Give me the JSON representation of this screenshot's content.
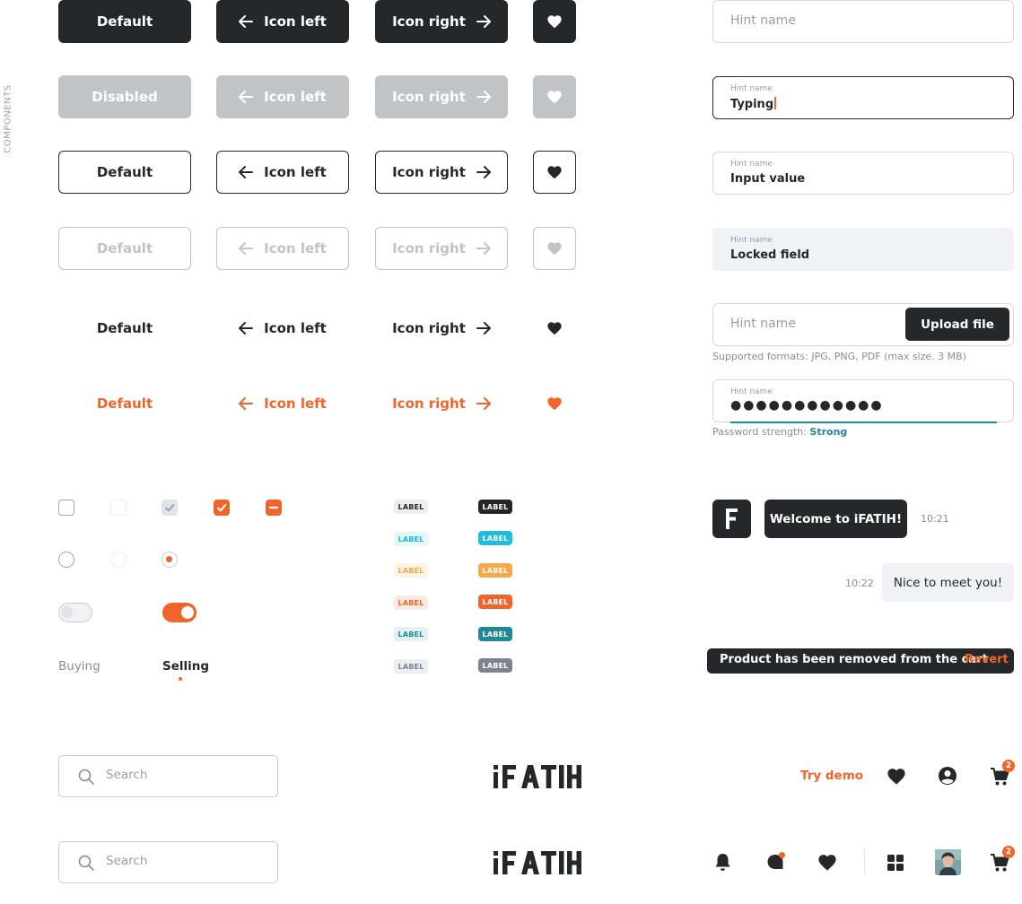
{
  "sidebar_label": "COMPONENTS",
  "colors": {
    "dark": "#26272b",
    "disabled": "#c2c3c6",
    "accent": "#f0652a",
    "teal": "#1f8a96"
  },
  "buttons": {
    "solid": {
      "default": "Default",
      "icon_left": "Icon left",
      "icon_right": "Icon right",
      "icon": "heart-icon"
    },
    "solid_disabled": {
      "default": "Disabled",
      "icon_left": "Icon left",
      "icon_right": "Icon right",
      "icon": "heart-icon"
    },
    "outline": {
      "default": "Default",
      "icon_left": "Icon left",
      "icon_right": "Icon right",
      "icon": "heart-icon"
    },
    "outline_disabled": {
      "default": "Default",
      "icon_left": "Icon left",
      "icon_right": "Icon right",
      "icon": "heart-icon"
    },
    "ghost": {
      "default": "Default",
      "icon_left": "Icon left",
      "icon_right": "Icon right",
      "icon": "heart-icon"
    },
    "ghost_accent": {
      "default": "Default",
      "icon_left": "Icon left",
      "icon_right": "Icon right",
      "icon": "heart-icon"
    }
  },
  "inputs": {
    "empty": {
      "placeholder": "Hint name"
    },
    "typing": {
      "hint": "Hint name",
      "value": "Typing"
    },
    "filled": {
      "hint": "Hint name",
      "value": "Input value"
    },
    "locked": {
      "hint": "Hint name",
      "value": "Locked field"
    },
    "upload": {
      "placeholder": "Hint name",
      "button": "Upload file",
      "helper": "Supported formats: JPG, PNG, PDF (max size. 3 MB)"
    },
    "password": {
      "hint": "Hint name",
      "value": "●●●●●●●●●●●●",
      "strength_label": "Password strength:",
      "strength_value": "Strong"
    }
  },
  "tabs": {
    "buying": "Buying",
    "selling": "Selling",
    "active": "Selling"
  },
  "labels": {
    "light": [
      "LABEL",
      "LABEL",
      "LABEL",
      "LABEL",
      "LABEL",
      "LABEL"
    ],
    "dark": [
      "LABEL",
      "LABEL",
      "LABEL",
      "LABEL",
      "LABEL",
      "LABEL"
    ]
  },
  "chat": {
    "avatar_letter": "F",
    "incoming": {
      "text": "Welcome to iFATIH!",
      "time": "10:21"
    },
    "outgoing": {
      "text": "Nice to meet you!",
      "time": "10:22"
    }
  },
  "toast": {
    "message": "Product has been removed from the cart",
    "action": "Revert"
  },
  "header1": {
    "search_placeholder": "Search",
    "logo": "iFATIH",
    "try_demo": "Try demo",
    "cart_count": "2"
  },
  "header2": {
    "search_placeholder": "Search",
    "logo": "iFATIH",
    "cart_count": "2"
  }
}
